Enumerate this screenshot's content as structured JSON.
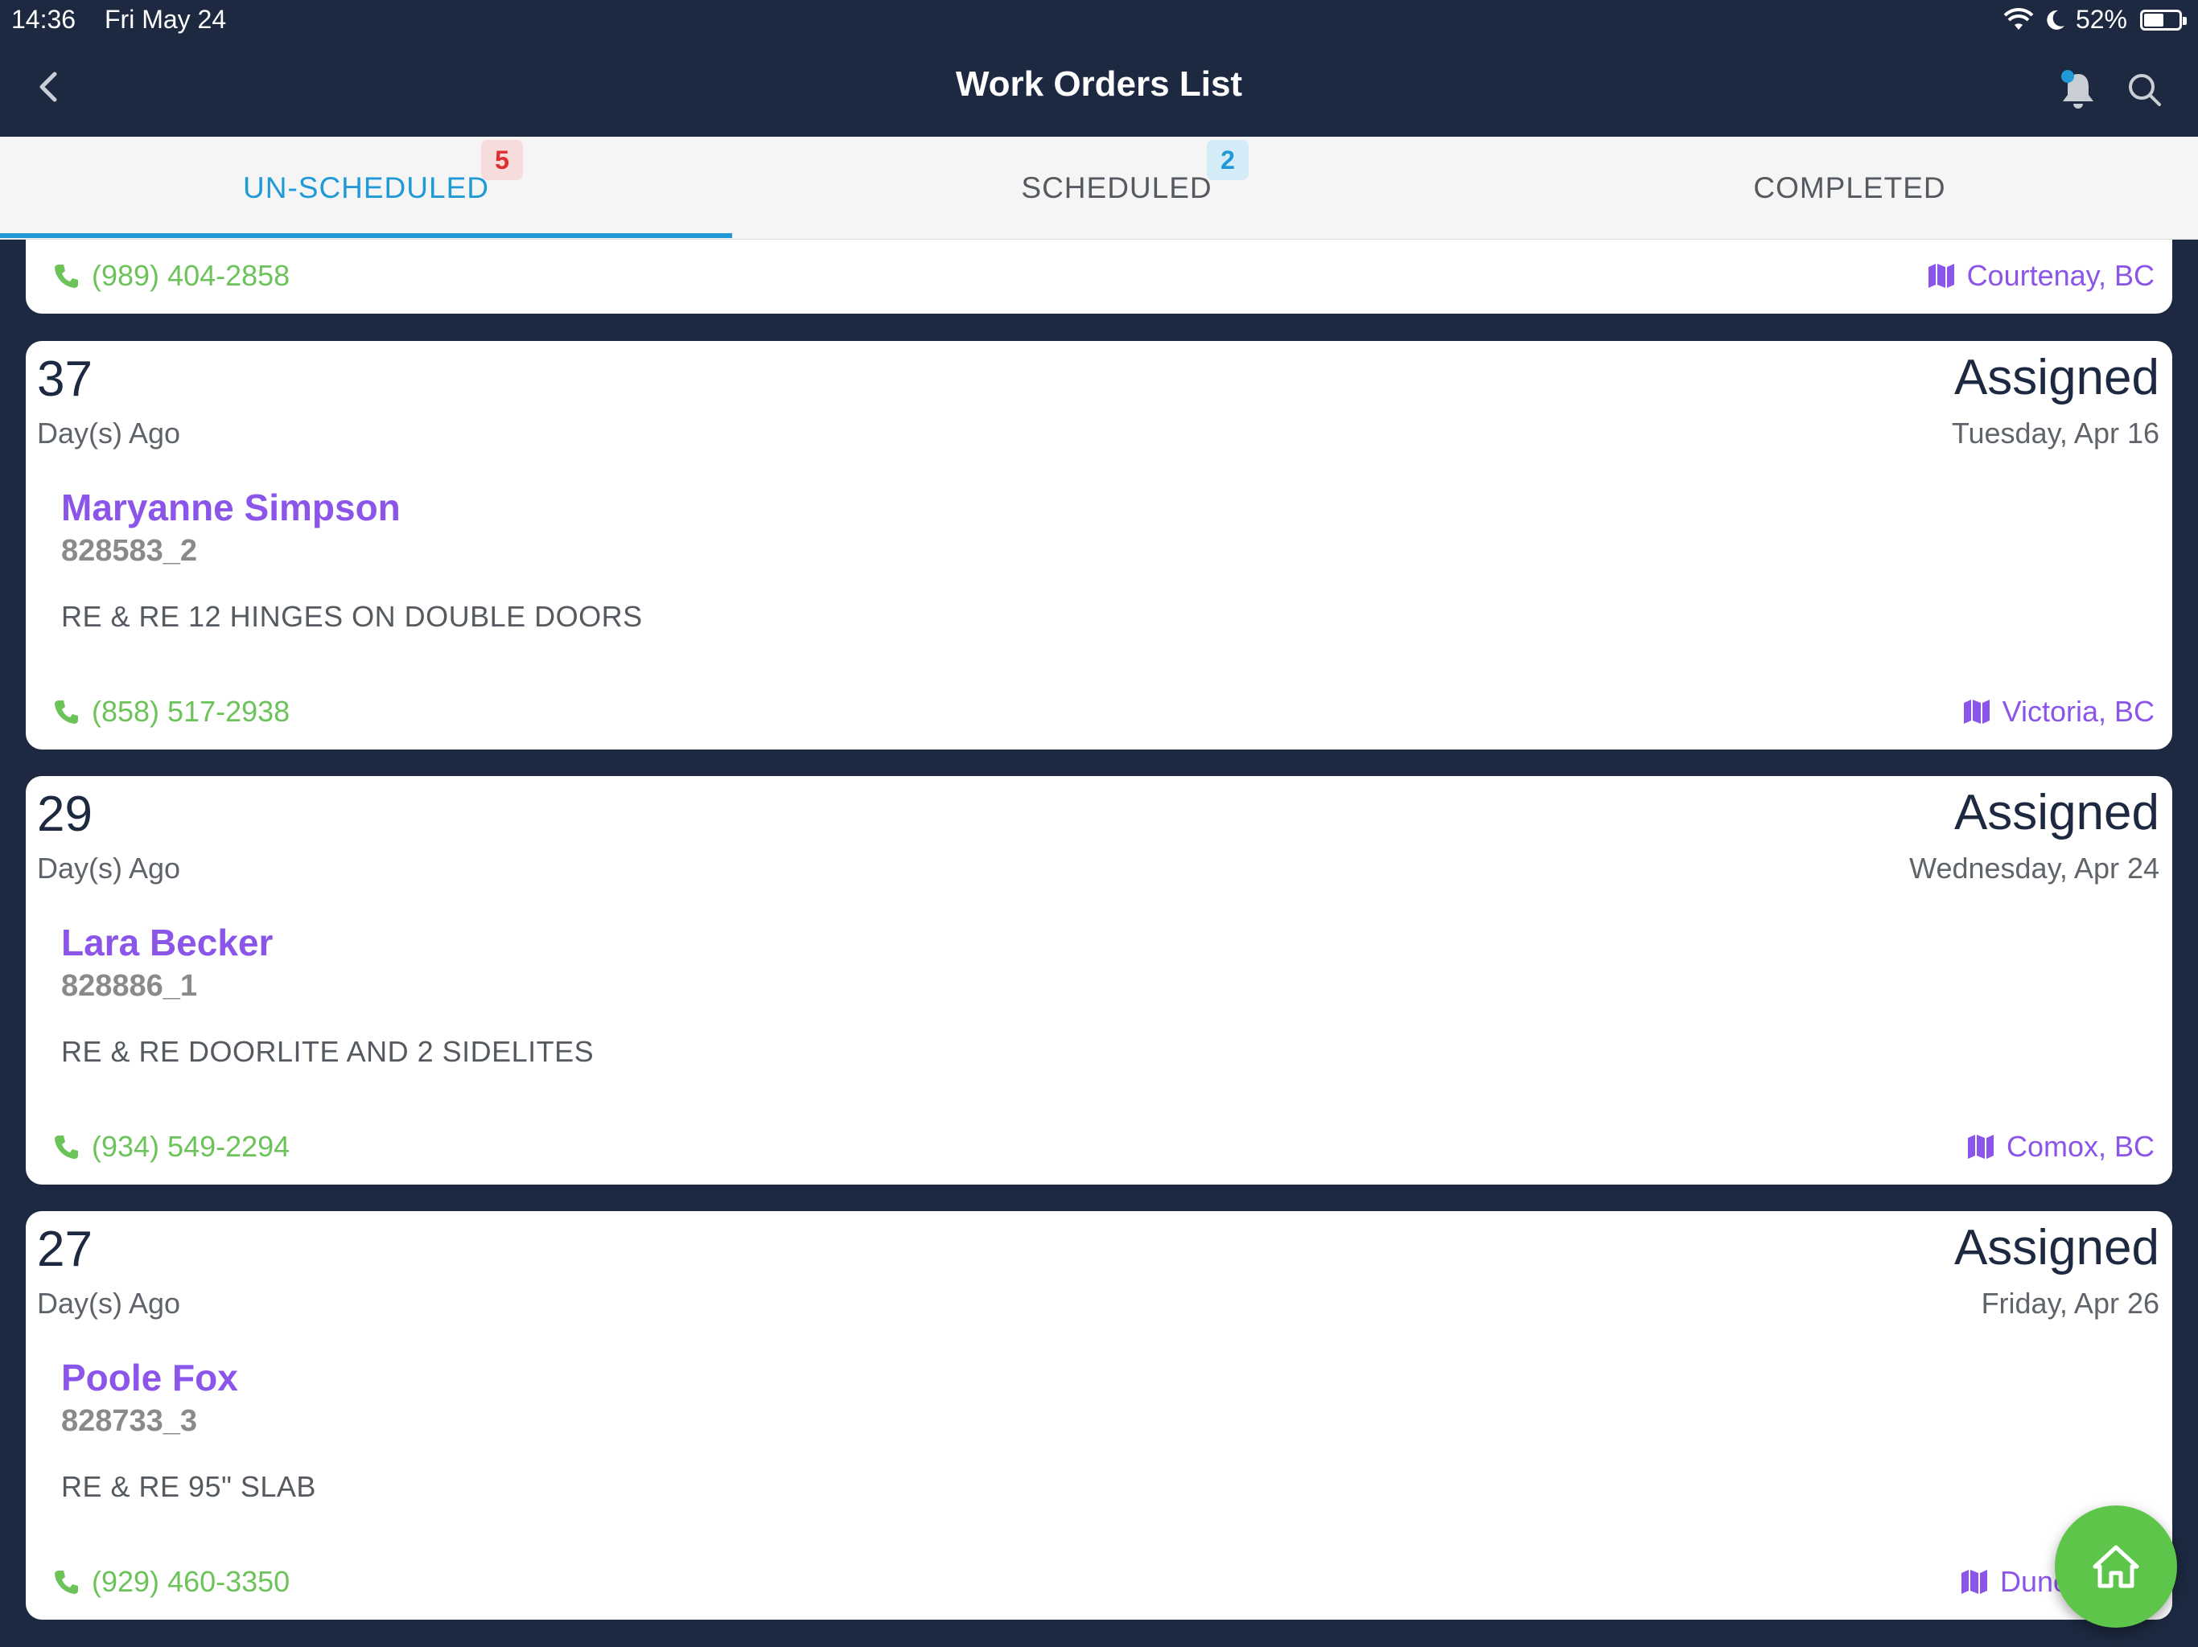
{
  "status_bar": {
    "time": "14:36",
    "date": "Fri May 24",
    "battery": "52%",
    "battery_level": 0.52
  },
  "nav": {
    "title": "Work Orders List",
    "back_icon": "chevron-left-icon",
    "notification_icon": "bell-icon",
    "search_icon": "search-icon"
  },
  "tabs": [
    {
      "label": "UN-SCHEDULED",
      "badge": "5",
      "active": true
    },
    {
      "label": "SCHEDULED",
      "badge": "2",
      "active": false
    },
    {
      "label": "COMPLETED",
      "badge": "",
      "active": false
    }
  ],
  "partial_card": {
    "phone": "(989) 404-2858",
    "location": "Courtenay, BC"
  },
  "work_orders": [
    {
      "days": "37",
      "days_label": "Day(s) Ago",
      "status": "Assigned",
      "date": "Tuesday, Apr 16",
      "name": "Maryanne Simpson",
      "order_id": "828583_2",
      "description": "RE & RE 12 HINGES ON DOUBLE DOORS",
      "phone": "(858) 517-2938",
      "location": "Victoria, BC"
    },
    {
      "days": "29",
      "days_label": "Day(s) Ago",
      "status": "Assigned",
      "date": "Wednesday, Apr 24",
      "name": "Lara Becker",
      "order_id": "828886_1",
      "description": "RE & RE DOORLITE AND 2 SIDELITES",
      "phone": "(934) 549-2294",
      "location": "Comox, BC"
    },
    {
      "days": "27",
      "days_label": "Day(s) Ago",
      "status": "Assigned",
      "date": "Friday, Apr 26",
      "name": "Poole Fox",
      "order_id": "828733_3",
      "description": "RE & RE 95\" SLAB",
      "phone": "(929) 460-3350",
      "location": "Dunc"
    }
  ],
  "fab": {
    "icon": "home-icon"
  },
  "colors": {
    "nav_bg": "#1c2940",
    "accent_blue": "#1f9ad6",
    "name_purple": "#8a55e8",
    "phone_green": "#6cc35a",
    "fab_green": "#5cc54a"
  }
}
